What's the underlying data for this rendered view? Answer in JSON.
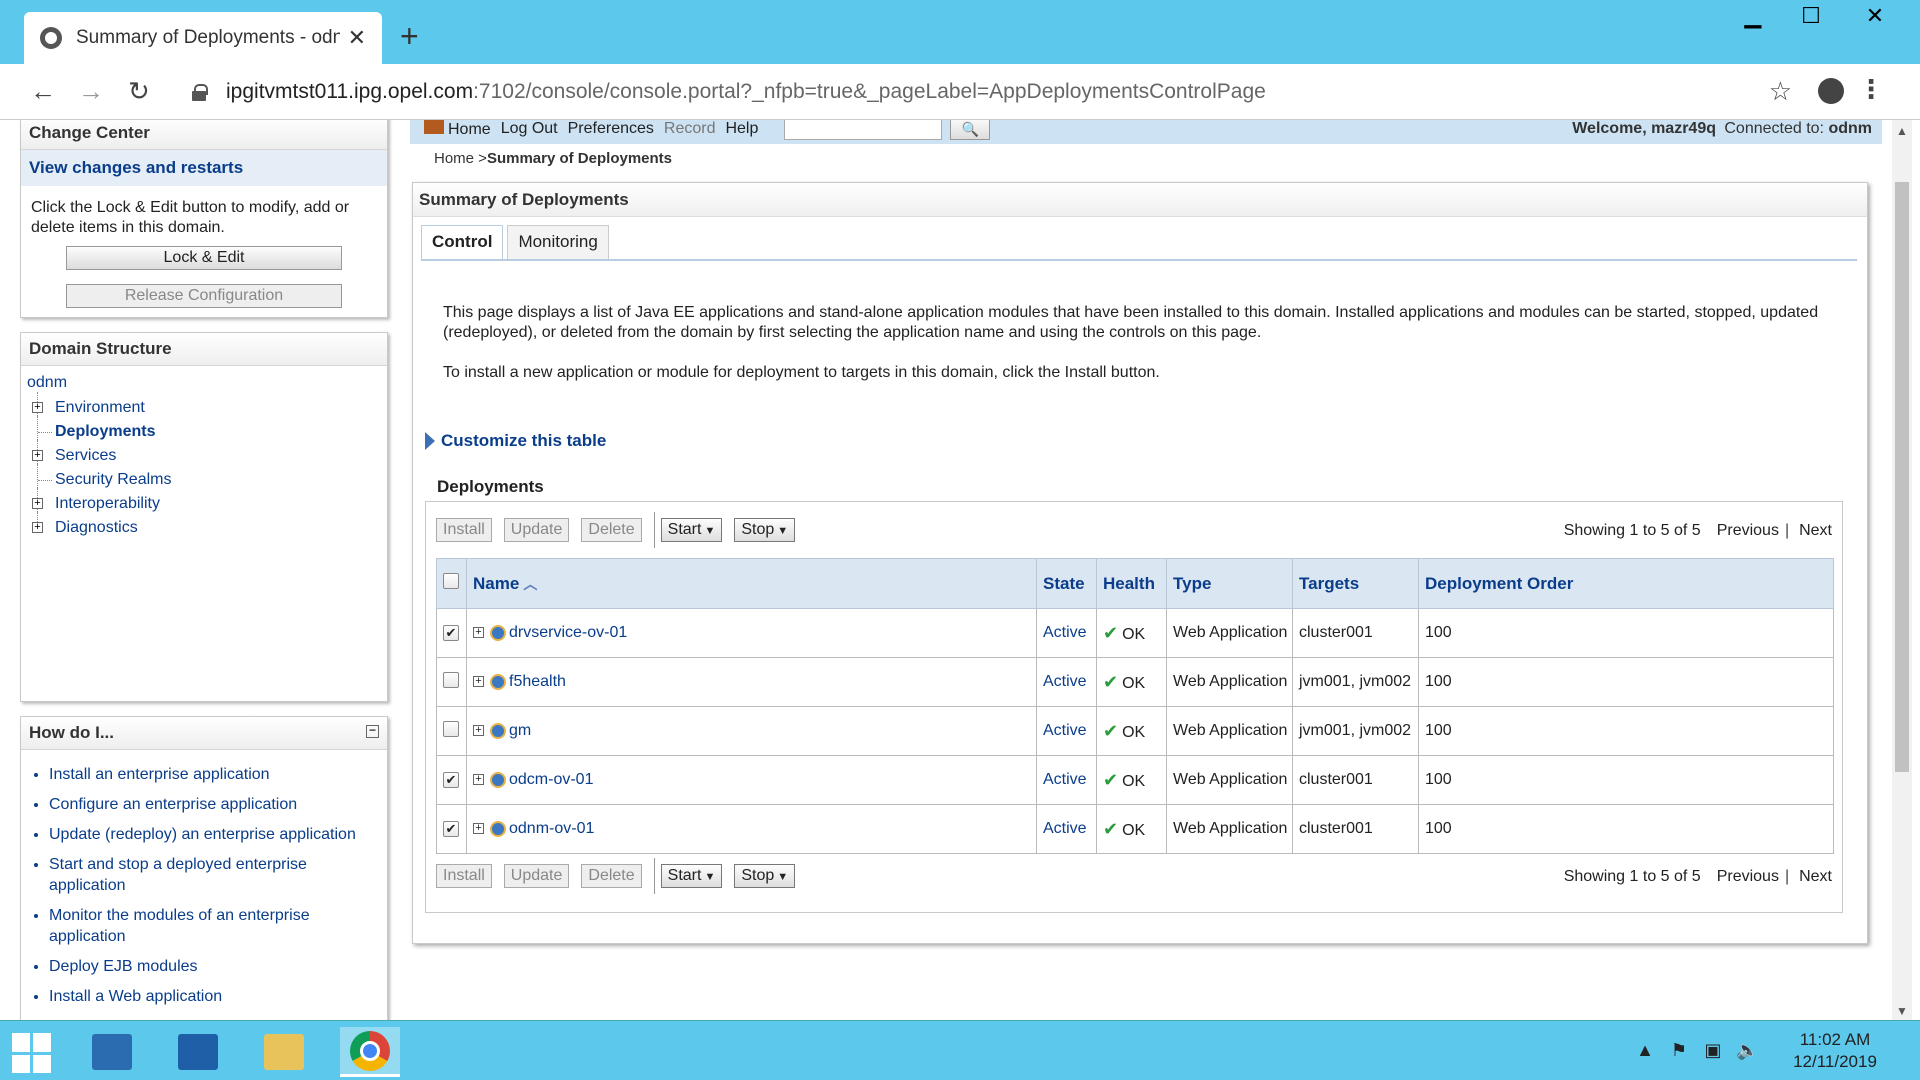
{
  "browser": {
    "tab_title": "Summary of Deployments - odnm",
    "tab_close": "✕",
    "new_tab": "+",
    "url_host": "ipgitvmtst011.ipg.opel.com",
    "url_rest": ":7102/console/console.portal?_nfpb=true&_pageLabel=AppDeploymentsControlPage",
    "back_icon": "arrow-left-icon",
    "forward_icon": "arrow-right-icon",
    "reload_icon": "reload-icon",
    "window_controls": [
      "minimize",
      "maximize",
      "close"
    ]
  },
  "toolbar": {
    "home": "Home",
    "logout": "Log Out",
    "preferences": "Preferences",
    "record": "Record",
    "help": "Help",
    "search_value": "",
    "welcome": "Welcome, mazr49q",
    "connected_label": "Connected to:",
    "connected_domain": "odnm"
  },
  "breadcrumb": {
    "home": "Home >",
    "current": "Summary of Deployments"
  },
  "change_center": {
    "title": "Change Center",
    "link": "View changes and restarts",
    "text": "Click the Lock & Edit button to modify, add or delete items in this domain.",
    "lock_edit": "Lock & Edit",
    "release": "Release Configuration"
  },
  "domain_structure": {
    "title": "Domain Structure",
    "root": "odnm",
    "items": [
      {
        "label": "Environment",
        "expandable": true
      },
      {
        "label": "Deployments",
        "expandable": false,
        "active": true
      },
      {
        "label": "Services",
        "expandable": true
      },
      {
        "label": "Security Realms",
        "expandable": false
      },
      {
        "label": "Interoperability",
        "expandable": true
      },
      {
        "label": "Diagnostics",
        "expandable": true
      }
    ]
  },
  "howdoi": {
    "title": "How do I...",
    "items": [
      "Install an enterprise application",
      "Configure an enterprise application",
      "Update (redeploy) an enterprise application",
      "Start and stop a deployed enterprise application",
      "Monitor the modules of an enterprise application",
      "Deploy EJB modules",
      "Install a Web application"
    ]
  },
  "main": {
    "title": "Summary of Deployments",
    "tabs": [
      "Control",
      "Monitoring"
    ],
    "desc1": "This page displays a list of Java EE applications and stand-alone application modules that have been installed to this domain. Installed applications and modules can be started, stopped, updated (redeployed), or deleted from the domain by first selecting the application name and using the controls on this page.",
    "desc2": "To install a new application or module for deployment to targets in this domain, click the Install button.",
    "customize": "Customize this table",
    "deployments_title": "Deployments",
    "buttons": {
      "install": "Install",
      "update": "Update",
      "delete": "Delete",
      "start": "Start",
      "stop": "Stop"
    },
    "paging": {
      "showing": "Showing 1 to 5 of 5",
      "previous": "Previous",
      "sep": "|",
      "next": "Next"
    },
    "columns": [
      "Name",
      "State",
      "Health",
      "Type",
      "Targets",
      "Deployment Order"
    ],
    "rows": [
      {
        "checked": true,
        "name": "drvservice-ov-01",
        "state": "Active",
        "health": "OK",
        "type": "Web Application",
        "targets": "cluster001",
        "order": "100"
      },
      {
        "checked": false,
        "name": "f5health",
        "state": "Active",
        "health": "OK",
        "type": "Web Application",
        "targets": "jvm001, jvm002",
        "order": "100"
      },
      {
        "checked": false,
        "name": "gm",
        "state": "Active",
        "health": "OK",
        "type": "Web Application",
        "targets": "jvm001, jvm002",
        "order": "100"
      },
      {
        "checked": true,
        "name": "odcm-ov-01",
        "state": "Active",
        "health": "OK",
        "type": "Web Application",
        "targets": "cluster001",
        "order": "100"
      },
      {
        "checked": true,
        "name": "odnm-ov-01",
        "state": "Active",
        "health": "OK",
        "type": "Web Application",
        "targets": "cluster001",
        "order": "100"
      }
    ]
  },
  "taskbar": {
    "time": "11:02 AM",
    "date": "12/11/2019"
  },
  "colors": {
    "chrome_bg": "#5bc8ec",
    "link": "#0a3d8a",
    "header_bg": "#dbe6f3"
  }
}
